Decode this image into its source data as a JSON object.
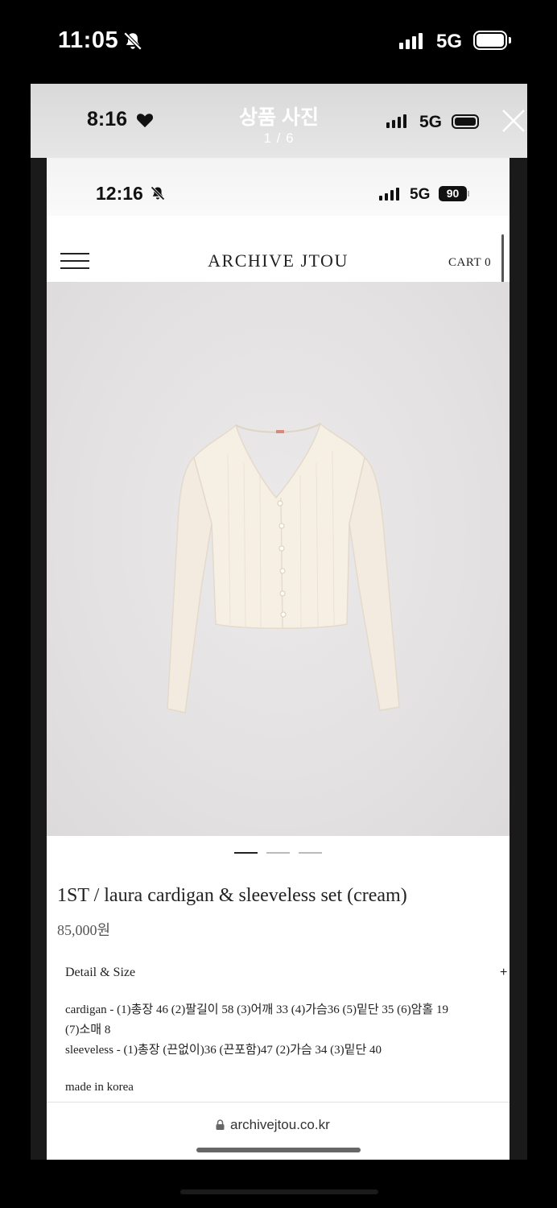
{
  "outer_status": {
    "time": "11:05",
    "network": "5G"
  },
  "viewer": {
    "status_time": "8:16",
    "title": "상품 사진",
    "counter": "1 / 6",
    "network": "5G"
  },
  "inner_status": {
    "time": "12:16",
    "network": "5G",
    "battery": "90"
  },
  "site": {
    "brand": "ARCHIVE JTOU",
    "cart": "CART 0"
  },
  "product": {
    "title": "1ST / laura cardigan & sleeveless set (cream)",
    "price": "85,000원",
    "image_slides": 3,
    "active_slide": 1,
    "details_heading": "Detail & Size",
    "expand_symbol": "+",
    "details": [
      "cardigan - (1)총장 46 (2)팔길이 58 (3)어깨 33 (4)가슴36 (5)밑단 35 (6)암홀 19",
      "(7)소매 8",
      "sleeveless - (1)총장 (끈없이)36 (끈포함)47 (2)가슴 34 (3)밑단 40"
    ],
    "origin": "made in korea"
  },
  "browser": {
    "url": "archivejtou.co.kr"
  },
  "icons": {
    "outer_bell": "bell-slash-icon",
    "inner_bell": "bell-slash-icon",
    "heart": "heart-icon",
    "close": "close-icon",
    "menu": "hamburger-menu-icon",
    "lock": "lock-icon"
  }
}
